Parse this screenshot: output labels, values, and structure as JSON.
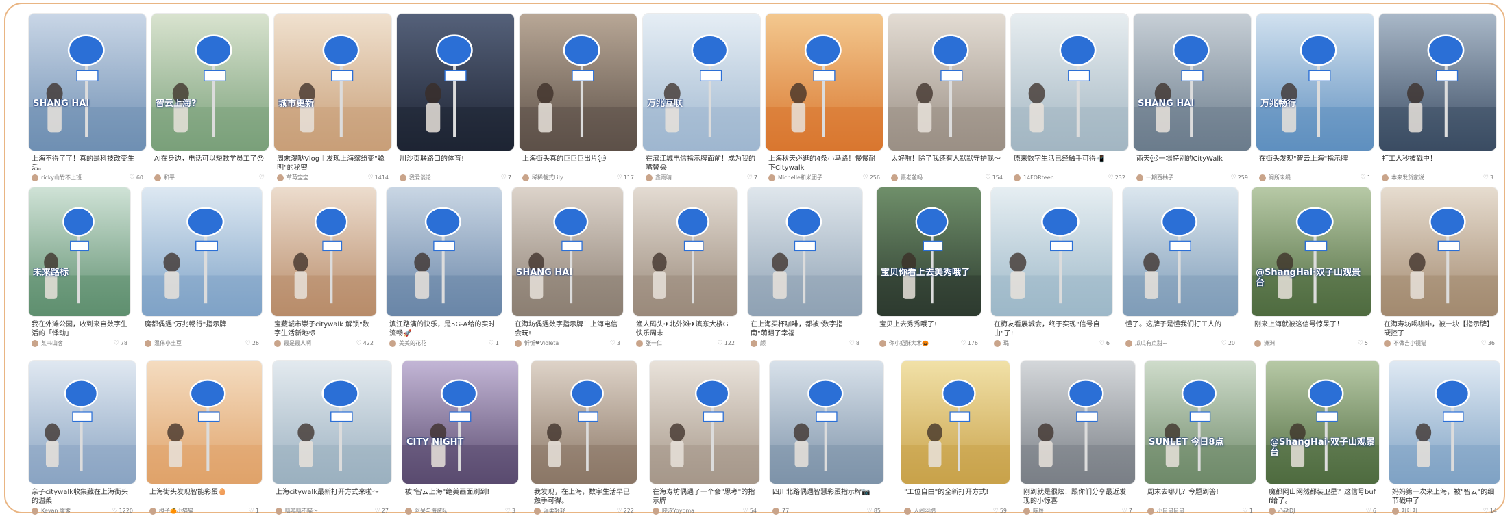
{
  "feed": {
    "notes": [
      {
        "caption": "上海不得了了！真的是科技改变生活。",
        "author": "ricky山竹不上班",
        "likes": "60",
        "bg": [
          "#6f8fb3",
          "#c9d6e6"
        ],
        "sign": "#2b6fd6",
        "overlay": "SHANG HAI"
      },
      {
        "caption": "AI在身边，电话可以短数学员工了😯",
        "author": "和平",
        "likes": "",
        "bg": [
          "#7aa07a",
          "#d9e3cf"
        ],
        "sign": "#2b6fd6",
        "overlay": "智云上海?"
      },
      {
        "caption": "周末漫哒Vlog｜发现上海缤纷变\"聪明\"的秘密",
        "author": "草莓宝宝",
        "likes": "1414",
        "bg": [
          "#c89f78",
          "#f0e1cf"
        ],
        "sign": "#2b6fd6",
        "overlay": "城市更新"
      },
      {
        "caption": "川沙页联路口的体育!",
        "author": "我爱谈论",
        "likes": "7",
        "bg": [
          "#1e2433",
          "#55617a"
        ],
        "sign": "#2b6fd6",
        "overlay": ""
      },
      {
        "caption": "上海街头真的巨巨巨出片💬",
        "author": "稀稀截式Lily",
        "likes": "117",
        "bg": [
          "#5d5148",
          "#b8a796"
        ],
        "sign": "#2b6fd6",
        "overlay": ""
      },
      {
        "caption": "在滨江城电信指示牌面前！成为我的嘴替😂",
        "author": "鑫雨晴",
        "likes": "7",
        "bg": [
          "#9fb7cf",
          "#e6eef5"
        ],
        "sign": "#2b6fd6",
        "overlay": "万兆互联"
      },
      {
        "caption": "上海秋天必逛的4条小马路！慢慢耐下Citywalk",
        "author": "Michelle和米团子",
        "likes": "256",
        "bg": [
          "#d9772f",
          "#f3c88f"
        ],
        "sign": "#2b6fd6",
        "overlay": ""
      },
      {
        "caption": "太好啦！除了我还有人默默守护我～",
        "author": "熹老爸吗",
        "likes": "154",
        "bg": [
          "#9a8f85",
          "#e3dcd3"
        ],
        "sign": "#2b6fd6",
        "overlay": ""
      },
      {
        "caption": "原来数字生活已经触手可得📲",
        "author": "14FORteen",
        "likes": "232",
        "bg": [
          "#a3b6c2",
          "#e7edf0"
        ],
        "sign": "#2b6fd6",
        "overlay": ""
      },
      {
        "caption": "雨天💬一場特别的CityWalk",
        "author": "一期西柚子",
        "likes": "259",
        "bg": [
          "#6b7c8c",
          "#c7cfd6"
        ],
        "sign": "#2b6fd6",
        "overlay": "SHANG HAI"
      },
      {
        "caption": "在街头发现\"智云上海\"指示牌",
        "author": "阁所未缇",
        "likes": "1",
        "bg": [
          "#5f8fbf",
          "#d1e1ef"
        ],
        "sign": "#2b6fd6",
        "overlay": "万兆畅行"
      },
      {
        "caption": "打工人秒被戳中！",
        "author": "本来发货家说",
        "likes": "3",
        "bg": [
          "#3b4c63",
          "#a9b8c8"
        ],
        "sign": "#2b6fd6",
        "overlay": ""
      },
      {
        "caption": "我在外滩公园，收到来自数字生活的「悸动」",
        "author": "某书山客",
        "likes": "78",
        "bg": [
          "#5f8f6f",
          "#cfe2d6"
        ],
        "sign": "#2b6fd6",
        "overlay": "未来路标"
      },
      {
        "caption": "魔都偶遇\"万兆畅行\"指示牌",
        "author": "温伟小土豆",
        "likes": "26",
        "bg": [
          "#7fa3c7",
          "#dde8f2"
        ],
        "sign": "#2b6fd6",
        "overlay": ""
      },
      {
        "caption": "宝藏城市崇子citywalk 解锁\"数字生活新地标",
        "author": "最是最人啊",
        "likes": "422",
        "bg": [
          "#b88c6a",
          "#ecdccd"
        ],
        "sign": "#2b6fd6",
        "overlay": ""
      },
      {
        "caption": "滨江路演的快乐，是5G-A给的实时流畅🚀",
        "author": "美美的花花",
        "likes": "1",
        "bg": [
          "#6a86a8",
          "#c9d6e4"
        ],
        "sign": "#2b6fd6",
        "overlay": ""
      },
      {
        "caption": "在海坊偶遇数字指示牌！上海电信会玩!",
        "author": "忻忻❤Violeta",
        "likes": "3",
        "bg": [
          "#8c7f73",
          "#dcd3ca"
        ],
        "sign": "#2b6fd6",
        "overlay": "SHANG HAI"
      },
      {
        "caption": "渔人码头✈北外滩✈滨东大楼G快乐周末",
        "author": "张一仁",
        "likes": "122",
        "bg": [
          "#9a8a7b",
          "#e3dbd2"
        ],
        "sign": "#2b6fd6",
        "overlay": ""
      },
      {
        "caption": "在上海买杯咖啡，都被\"数字指南\"萌翻了幸福",
        "author": "颜",
        "likes": "8",
        "bg": [
          "#8fa2b4",
          "#dfe6ec"
        ],
        "sign": "#2b6fd6",
        "overlay": ""
      },
      {
        "caption": "宝贝上去秀秀哦了!",
        "author": "你小奶酥大术🎃",
        "likes": "176",
        "bg": [
          "#2d3b2f",
          "#6f8f6a"
        ],
        "sign": "#2b6fd6",
        "overlay": "宝贝你看上去美秀哦了"
      },
      {
        "caption": "在梅友看展城会，终于实现\"信号自由\"了!",
        "author": "璐",
        "likes": "6",
        "bg": [
          "#9db8c8",
          "#e6eef2"
        ],
        "sign": "#2b6fd6",
        "overlay": ""
      },
      {
        "caption": "懂了。这牌子是懂我们打工人的",
        "author": "瓜瓜有点甜~",
        "likes": "20",
        "bg": [
          "#7f9cb8",
          "#dbe6ee"
        ],
        "sign": "#2b6fd6",
        "overlay": ""
      },
      {
        "caption": "刚来上海就被这信号惊呆了！",
        "author": "洲洲",
        "likes": "5",
        "bg": [
          "#4f6b3f",
          "#b7c9a6"
        ],
        "sign": "#2b6fd6",
        "overlay": "@ShangHai·双子山观景台"
      },
      {
        "caption": "在海寿坊喝咖啡，被一块【指示牌】硬控了",
        "author": "不做吉小镜猫",
        "likes": "36",
        "bg": [
          "#a38a70",
          "#e6dccf"
        ],
        "sign": "#2b6fd6",
        "overlay": ""
      },
      {
        "caption": "亲子citywalk收集藏在上海街头的温柔",
        "author": "Kevan 爹爹",
        "likes": "1220",
        "bg": [
          "#8aa4c2",
          "#e0e8f1"
        ],
        "sign": "#2b6fd6",
        "overlay": ""
      },
      {
        "caption": "上海街头发现智能彩蛋🥚",
        "author": "橙子🍊小猫猫",
        "likes": "1",
        "bg": [
          "#e0a36a",
          "#f4dcc0"
        ],
        "sign": "#2b6fd6",
        "overlay": ""
      },
      {
        "caption": "上海citywalk最新打开方式来啦～",
        "author": "嘻嘻嘻不喵～",
        "likes": "27",
        "bg": [
          "#9bb0c0",
          "#e3eaef"
        ],
        "sign": "#2b6fd6",
        "overlay": ""
      },
      {
        "caption": "被\"智云上海\"绝美画面刷到!",
        "author": "阿呆与海贼队",
        "likes": "3",
        "bg": [
          "#5a4b6f",
          "#c3b6d6"
        ],
        "sign": "#2b6fd6",
        "overlay": "CITY NIGHT"
      },
      {
        "caption": "我发现，在上海，数字生活早已触手可得。",
        "author": "温柔轻轻",
        "likes": "222",
        "bg": [
          "#8b7766",
          "#ded3c8"
        ],
        "sign": "#2b6fd6",
        "overlay": ""
      },
      {
        "caption": "在海寿坊偶遇了一个会\"思考\"的指示牌",
        "author": "晓汐Yoyoma",
        "likes": "54",
        "bg": [
          "#a6988a",
          "#e9e2da"
        ],
        "sign": "#2b6fd6",
        "overlay": ""
      },
      {
        "caption": "四川北路偶遇智慧彩蛋指示牌📷",
        "author": "77",
        "likes": "85",
        "bg": [
          "#7e93a9",
          "#d8e1ea"
        ],
        "sign": "#2b6fd6",
        "overlay": ""
      },
      {
        "caption": "\"工位自由\"的全新打开方式!",
        "author": "人间羽绵",
        "likes": "59",
        "bg": [
          "#c9a24a",
          "#f1e1a8"
        ],
        "sign": "#2b6fd6",
        "overlay": ""
      },
      {
        "caption": "刚到就是很炫！跟你们分享最近发现的小惊喜",
        "author": "陈辰",
        "likes": "7",
        "bg": [
          "#7a7f86",
          "#d4d7da"
        ],
        "sign": "#2b6fd6",
        "overlay": ""
      },
      {
        "caption": "周末去哪儿？今题到答!",
        "author": "小鼠鼠鼠鼠",
        "likes": "1",
        "bg": [
          "#6f8a6a",
          "#cfdccb"
        ],
        "sign": "#2b6fd6",
        "overlay": "SUNLET 今日8点"
      },
      {
        "caption": "魔都网山网然都装卫星？这信号buff给了。",
        "author": "心动DJ",
        "likes": "6",
        "bg": [
          "#4f6b3f",
          "#b7c9a6"
        ],
        "sign": "#2b6fd6",
        "overlay": "@ShangHai·双子山观景台"
      },
      {
        "caption": "妈妈第一次来上海，被\"智云\"的细节戳中了",
        "author": "叶叶叶",
        "likes": "14",
        "bg": [
          "#7fa2c4",
          "#dfe9f3"
        ],
        "sign": "#2b6fd6",
        "overlay": ""
      }
    ]
  }
}
